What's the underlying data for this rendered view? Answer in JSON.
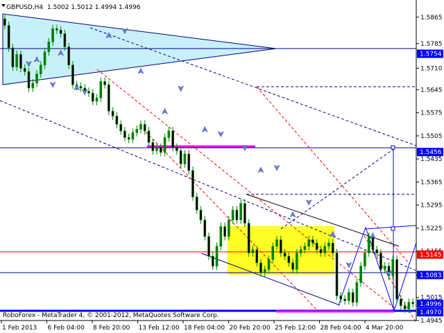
{
  "header": {
    "symbol_timeframe": "GBPUSD,H4",
    "ohlc": "1.5002 1.5012 1.4994 1.4996"
  },
  "footer": {
    "broker": "RoboForex - MetaTrader 4, © 2001-2012, MetaQuotes Software Corp."
  },
  "colors": {
    "background": "#ffffff",
    "grid_frame": "#000000",
    "candle": "#008000",
    "triangle_fill": "#c8f0f8",
    "triangle_edge": "#00008c",
    "flag_fill": "#ffff00",
    "magenta_level": "#ff00ff",
    "blue_level": "#0000ff",
    "red_level": "#ff0000",
    "arrow_marker": "#6a7fd8",
    "tag_blue": "#0000ff",
    "tag_red": "#ff0000"
  },
  "chart_data": {
    "type": "candlestick",
    "title": "GBPUSD,H4",
    "xlabel": "",
    "ylabel": "",
    "ylim": [
      1.4945,
      1.5875
    ],
    "grid": false,
    "x_tick_labels": [
      "1 Feb 2013",
      "6 Feb 04:00",
      "8 Feb 20:00",
      "13 Feb 12:00",
      "18 Feb 04:00",
      "20 Feb 20:00",
      "25 Feb 12:00",
      "28 Feb 04:00",
      "4 Mar 20:00"
    ],
    "y_tick_labels": [
      "1.5865",
      "1.5785",
      "1.5710",
      "1.5645",
      "1.5575",
      "1.5505",
      "1.5435",
      "1.5365",
      "1.5295",
      "1.5225",
      "1.5155",
      "1.5083",
      "1.5015",
      "1.4945"
    ],
    "price_tags": [
      {
        "label": "1.5754",
        "value": 1.5754,
        "color": "blue"
      },
      {
        "label": "1.5456",
        "value": 1.5456,
        "color": "blue"
      },
      {
        "label": "1.5145",
        "value": 1.5145,
        "color": "red"
      },
      {
        "label": "1.5083",
        "value": 1.5083,
        "color": "blue"
      },
      {
        "label": "1.4996",
        "value": 1.4996,
        "color": "blue"
      },
      {
        "label": "1.4970",
        "value": 1.497,
        "color": "blue"
      }
    ],
    "horizontal_levels": [
      {
        "value": 1.5754,
        "color": "blue"
      },
      {
        "value": 1.5456,
        "color": "blue"
      },
      {
        "value": 1.5145,
        "color": "red"
      },
      {
        "value": 1.5083,
        "color": "blue"
      },
      {
        "value": 1.497,
        "color": "blue"
      }
    ],
    "close_series": [
      1.584,
      1.5772,
      1.5714,
      1.5752,
      1.571,
      1.57,
      1.565,
      1.5665,
      1.5693,
      1.572,
      1.576,
      1.579,
      1.583,
      1.5826,
      1.5815,
      1.5775,
      1.572,
      1.566,
      1.5655,
      1.565,
      1.564,
      1.5635,
      1.561,
      1.562,
      1.567,
      1.566,
      1.558,
      1.5565,
      1.554,
      1.552,
      1.55,
      1.5495,
      1.5515,
      1.5525,
      1.554,
      1.552,
      1.5485,
      1.546,
      1.547,
      1.5455,
      1.55,
      1.552,
      1.547,
      1.546,
      1.542,
      1.545,
      1.54,
      1.532,
      1.528,
      1.525,
      1.52,
      1.514,
      1.511,
      1.517,
      1.523,
      1.52,
      1.525,
      1.528,
      1.525,
      1.53,
      1.524,
      1.515,
      1.516,
      1.512,
      1.509,
      1.51,
      1.513,
      1.517,
      1.519,
      1.515,
      1.514,
      1.512,
      1.51,
      1.515,
      1.516,
      1.517,
      1.519,
      1.518,
      1.516,
      1.515,
      1.517,
      1.518,
      1.515,
      1.502,
      1.501,
      1.5005,
      1.503,
      1.5,
      1.506,
      1.511,
      1.515,
      1.52,
      1.516,
      1.515,
      1.51,
      1.511,
      1.508,
      1.513,
      1.501,
      1.499,
      1.498,
      1.5,
      1.4996
    ],
    "arrow_markers_up": [
      [
        8,
        1.5735
      ],
      [
        14,
        1.5755
      ],
      [
        18,
        1.565
      ],
      [
        26,
        1.5808
      ],
      [
        34,
        1.57
      ],
      [
        40,
        1.5578
      ],
      [
        50,
        1.5523
      ],
      [
        64,
        1.54
      ],
      [
        72,
        1.5265
      ],
      [
        82,
        1.5205
      ],
      [
        92,
        1.52
      ],
      [
        104,
        1.5175
      ],
      [
        110,
        1.5205
      ],
      [
        130,
        1.517
      ]
    ],
    "arrow_markers_down": [
      [
        6,
        1.5725
      ],
      [
        12,
        1.5662
      ],
      [
        20,
        1.564
      ],
      [
        30,
        1.5825
      ],
      [
        44,
        1.565
      ],
      [
        54,
        1.5512
      ],
      [
        60,
        1.547
      ],
      [
        68,
        1.541
      ],
      [
        76,
        1.5305
      ],
      [
        86,
        1.5115
      ],
      [
        96,
        1.509
      ],
      [
        106,
        1.515
      ],
      [
        116,
        1.4985
      ],
      [
        126,
        1.496
      ]
    ]
  }
}
